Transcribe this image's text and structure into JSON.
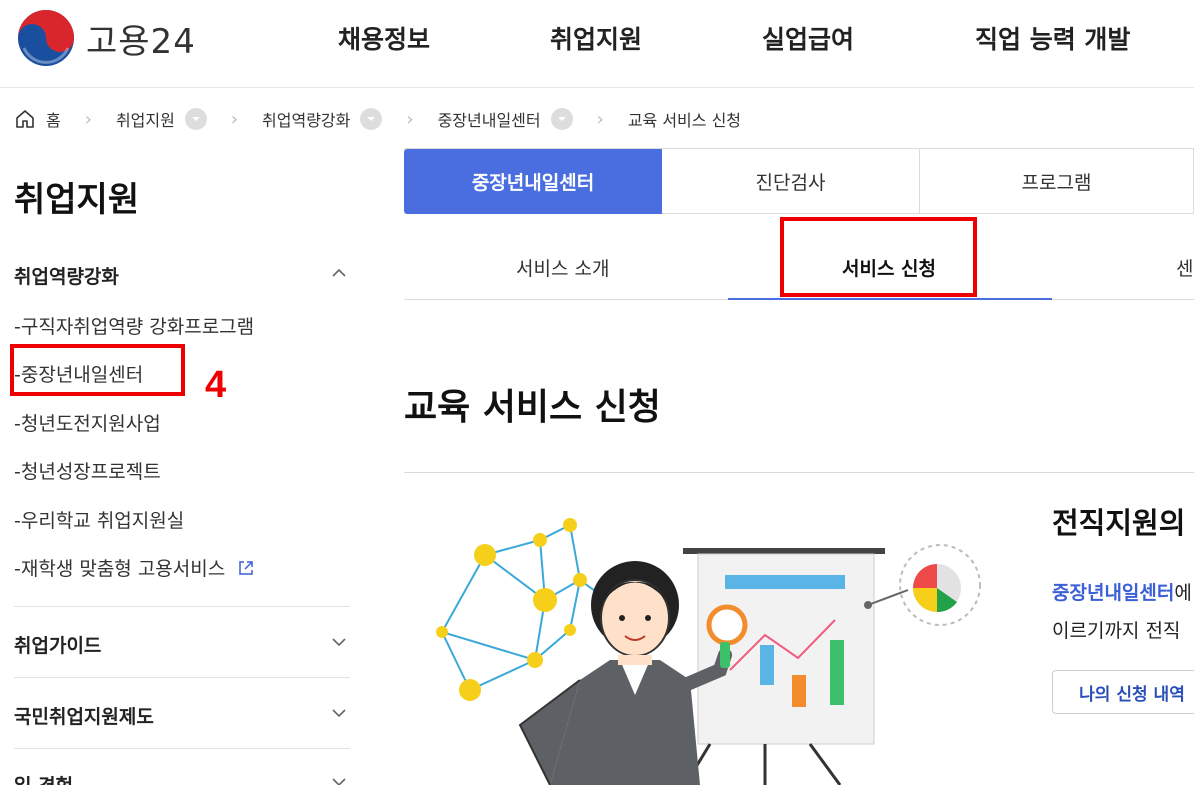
{
  "header": {
    "logo_text": "고용24",
    "nav": [
      "채용정보",
      "취업지원",
      "실업급여",
      "직업 능력 개발"
    ]
  },
  "breadcrumb": {
    "home": "홈",
    "items": [
      "취업지원",
      "취업역량강화",
      "중장년내일센터",
      "교육 서비스 신청"
    ]
  },
  "sidebar": {
    "title": "취업지원",
    "sections": [
      {
        "label": "취업역량강화",
        "expanded": true,
        "items": [
          "-구직자취업역량 강화프로그램",
          "-중장년내일센터",
          "-청년도전지원사업",
          "-청년성장프로젝트",
          "-우리학교 취업지원실",
          "-재학생 맞춤형 고용서비스"
        ]
      },
      {
        "label": "취업가이드",
        "expanded": false
      },
      {
        "label": "국민취업지원제도",
        "expanded": false
      },
      {
        "label": "일 경험",
        "expanded": false
      }
    ]
  },
  "annotation": {
    "number": "4",
    "color": "#e00000"
  },
  "tabs": [
    "중장년내일센터",
    "진단검사",
    "프로그램"
  ],
  "subtabs": [
    "서비스 소개",
    "서비스 신청",
    "센"
  ],
  "main": {
    "heading": "교육 서비스 신청",
    "intro_title": "전직지원의",
    "intro_highlight": "중장년내일센터",
    "intro_after_highlight": "에",
    "intro_line2": "이르기까지 전직",
    "my_button": "나의 신청 내역"
  },
  "colors": {
    "accent": "#4a6ee0",
    "annotation": "#e00000"
  }
}
